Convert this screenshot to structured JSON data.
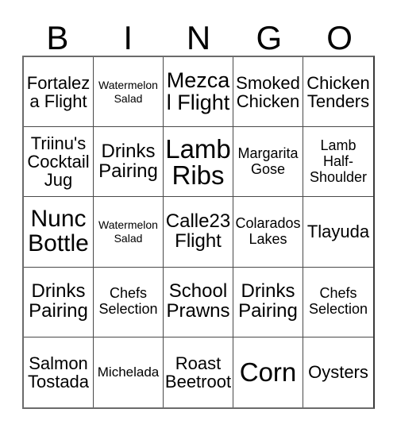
{
  "card": {
    "header_letters": [
      "B",
      "I",
      "N",
      "G",
      "O"
    ],
    "colors": {
      "background": "#ffffff",
      "text": "#000000",
      "grid_line": "#4a4a4a",
      "grid_outer": "#6b6b6b"
    },
    "rows": [
      [
        {
          "label": "Fortaleza Flight",
          "size": "ml"
        },
        {
          "label": "Watermelon Salad",
          "size": "xs"
        },
        {
          "label": "Mezcal Flight",
          "size": "xl"
        },
        {
          "label": "Smoked Chicken",
          "size": "ml"
        },
        {
          "label": "Chicken Tenders",
          "size": "ml"
        }
      ],
      [
        {
          "label": "Triinu's Cocktail Jug",
          "size": "ml"
        },
        {
          "label": "Drinks Pairing",
          "size": "l"
        },
        {
          "label": "Lamb Ribs",
          "size": "huge"
        },
        {
          "label": "Margarita Gose",
          "size": "sm"
        },
        {
          "label": "Lamb Half-Shoulder",
          "size": "sm"
        }
      ],
      [
        {
          "label": "Nunc Bottle",
          "size": "xxl"
        },
        {
          "label": "Watermelon Salad",
          "size": "xs"
        },
        {
          "label": "Calle23 Flight",
          "size": "l"
        },
        {
          "label": "Colarados Lakes",
          "size": "sm"
        },
        {
          "label": "Tlayuda",
          "size": "ml"
        }
      ],
      [
        {
          "label": "Drinks Pairing",
          "size": "l"
        },
        {
          "label": "Chefs Selection",
          "size": "sm"
        },
        {
          "label": "School Prawns",
          "size": "l"
        },
        {
          "label": "Drinks Pairing",
          "size": "l"
        },
        {
          "label": "Chefs Selection",
          "size": "sm"
        }
      ],
      [
        {
          "label": "Salmon Tostada",
          "size": "ml"
        },
        {
          "label": "Michelada",
          "size": "s"
        },
        {
          "label": "Roast Beetroot",
          "size": "ml"
        },
        {
          "label": "Corn",
          "size": "huge"
        },
        {
          "label": "Oysters",
          "size": "ml"
        }
      ]
    ]
  }
}
